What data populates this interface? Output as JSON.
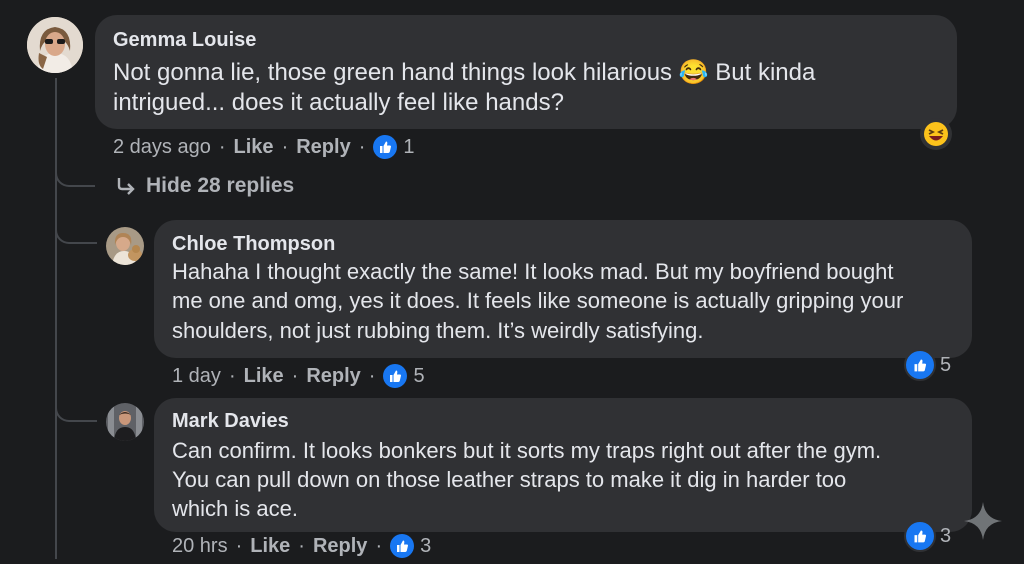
{
  "comments": [
    {
      "author": "Gemma Louise",
      "line1": "Not gonna lie, those green hand things look hilarious",
      "line1_emoji": "😂",
      "line1_tail": "But kinda",
      "line2": "intrigued... does it actually feel like hands?",
      "time": "2 days ago",
      "like": "Like",
      "reply": "Reply",
      "likes": "1",
      "bubble_reaction_icon": "laughing-emoji-icon"
    }
  ],
  "hide_replies": "Hide 28 replies",
  "replies": [
    {
      "author": "Chloe Thompson",
      "lines": [
        "Hahaha I thought exactly the same! It looks mad. But my boyfriend bought",
        "me one and omg, yes it does. It feels like someone is actually gripping your",
        "shoulders, not just rubbing them. It’s weirdly satisfying."
      ],
      "time": "1 day",
      "like": "Like",
      "reply": "Reply",
      "likes": "5",
      "reaction_count": "5"
    },
    {
      "author": "Mark Davies",
      "lines": [
        "Can confirm. It looks bonkers but it sorts my traps right out after the gym.",
        "You can pull down on those leather straps to make it dig in harder too",
        "which is ace."
      ],
      "time": "20 hrs",
      "like": "Like",
      "reply": "Reply",
      "likes": "3",
      "reaction_count": "3"
    }
  ],
  "separator": "·",
  "colors": {
    "background": "#1b1c1e",
    "bubble": "#303134",
    "like_blue": "#1877f2",
    "meta": "#b0b3b8"
  }
}
